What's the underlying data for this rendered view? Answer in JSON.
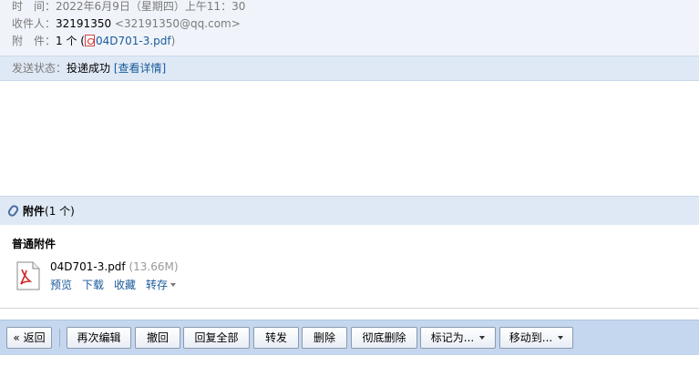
{
  "header": {
    "time_label": "时　间：",
    "time_value": "2022年6月9日（星期四）上午11：30",
    "recipient_label": "收件人：",
    "recipient_name": "32191350",
    "recipient_email": "<32191350@qq.com>",
    "attachment_label": "附　件：",
    "attachment_count": "1 个 (",
    "attachment_file": "04D701-3.pdf",
    "attachment_close": ")"
  },
  "status": {
    "label": "发送状态：",
    "value": "投递成功",
    "details_link": "[查看详情]"
  },
  "attachments": {
    "title": "附件",
    "count": "(1 个)",
    "section_title": "普通附件",
    "file": {
      "name": "04D701-3.pdf",
      "size": "(13.66M)",
      "icon": "pdf-file-icon",
      "actions": {
        "preview": "预览",
        "download": "下载",
        "favorite": "收藏",
        "save_to": "转存"
      }
    }
  },
  "toolbar": {
    "back": "« 返回",
    "edit_again": "再次编辑",
    "recall": "撤回",
    "reply_all": "回复全部",
    "forward": "转发",
    "delete": "删除",
    "delete_permanently": "彻底删除",
    "mark_as": "标记为...",
    "move_to": "移动到..."
  },
  "colors": {
    "header_bg": "#f0f4fa",
    "band_bg": "#dfe9f5",
    "toolbar_bg": "#c5d7ee",
    "link": "#1a5a9a"
  }
}
